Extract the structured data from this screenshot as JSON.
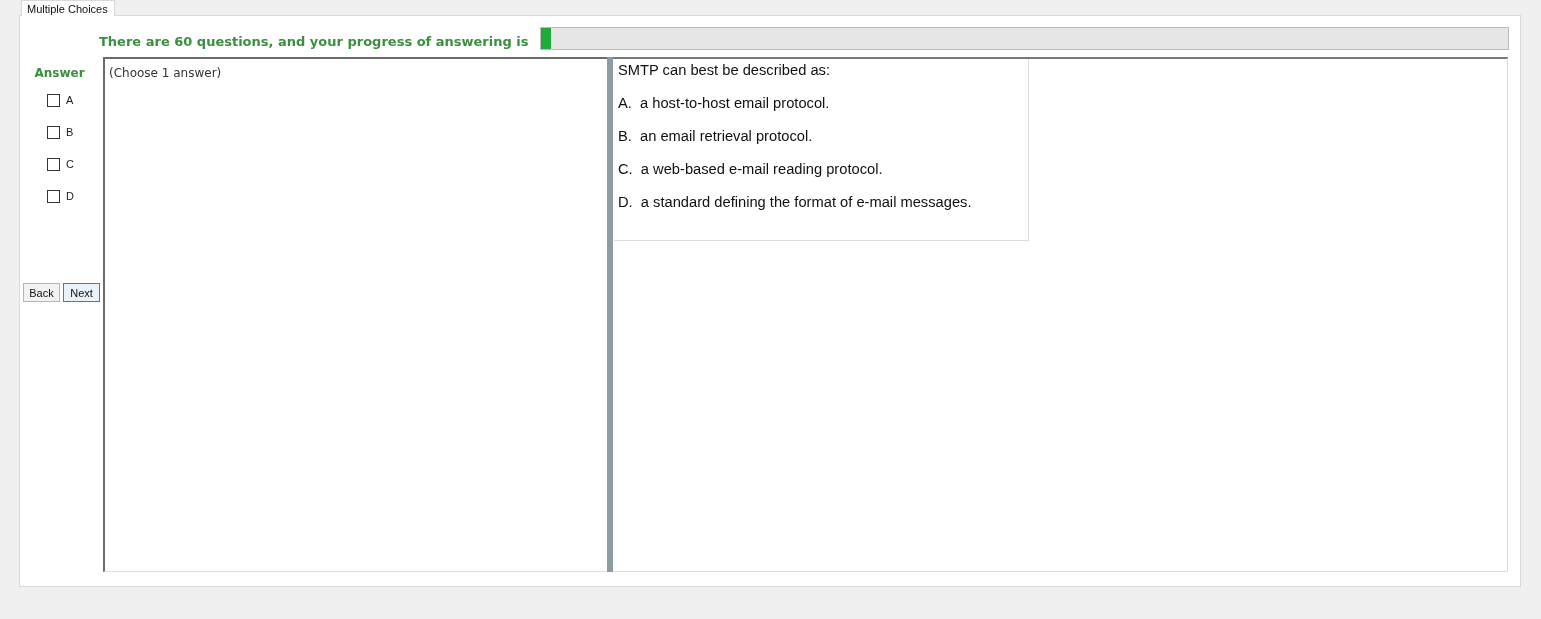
{
  "tabs": [
    {
      "label": "Multiple Choices",
      "selected": true
    }
  ],
  "progress": {
    "label": "There are 60 questions, and your progress of answering is",
    "level": 0.01
  },
  "answer_panel": {
    "title": "Answer",
    "options": [
      {
        "label": "A",
        "checked": false
      },
      {
        "label": "B",
        "checked": false
      },
      {
        "label": "C",
        "checked": false
      },
      {
        "label": "D",
        "checked": false
      }
    ]
  },
  "buttons": [
    {
      "label": "Back",
      "focused": false
    },
    {
      "label": "Next",
      "focused": true
    }
  ],
  "answer_text": {
    "text": "(Choose 1 answer)"
  },
  "question": {
    "stem": "SMTP can best be described as:",
    "choices": [
      "A.  a host-to-host email protocol.",
      "B.  an email retrieval protocol.",
      "C.  a web-based e-mail reading protocol.",
      "D.  a standard defining the format of e-mail messages."
    ]
  }
}
